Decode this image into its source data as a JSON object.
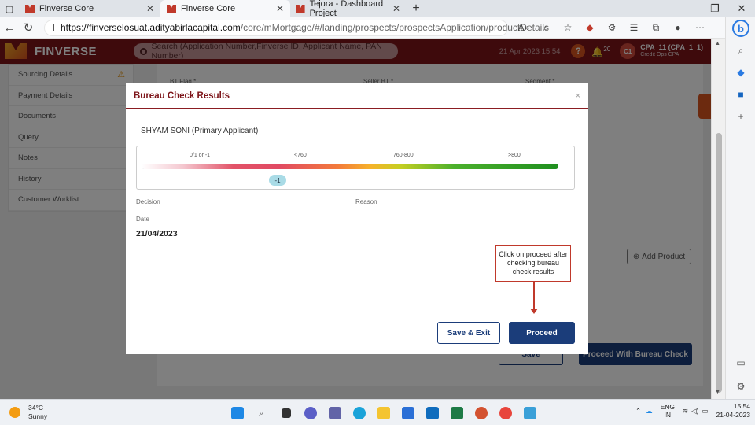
{
  "browser": {
    "tabs": [
      {
        "title": "Finverse Core",
        "active": false
      },
      {
        "title": "Finverse Core",
        "active": true
      },
      {
        "title": "Tejora - Dashboard Project",
        "active": false
      }
    ],
    "url_host": "https://finverselosuat.adityabirlacapital.com",
    "url_path": "/core/mMortgage/#/landing/prospects/prospectsApplication/productDetails"
  },
  "app": {
    "logo": "FINVERSE",
    "search_placeholder": "Search (Application Number,Finverse ID, Applicant Name, PAN Number)",
    "datetime": "21 Apr 2023 15:54",
    "notifications": "20",
    "avatar_initials": "C1",
    "user_name": "CPA_11 (CPA_1_1)",
    "user_role": "Credit Ops CPA",
    "accent_color": "#7d1419",
    "primary_button_color": "#1b3d7a"
  },
  "sidebar": {
    "items": [
      {
        "label": "Sourcing Details"
      },
      {
        "label": "Payment Details"
      },
      {
        "label": "Documents"
      },
      {
        "label": "Query"
      },
      {
        "label": "Notes"
      },
      {
        "label": "History"
      },
      {
        "label": "Customer Worklist"
      }
    ]
  },
  "form": {
    "bt_flag_label": "BT Flag *",
    "seller_bt_label": "Seller BT *",
    "segment_label": "Segment *",
    "add_product": "Add Product",
    "save": "Save",
    "proceed_with_bureau": "Proceed With Bureau Check"
  },
  "modal": {
    "title": "Bureau Check Results",
    "close": "×",
    "applicant": "SHYAM SONI (Primary Applicant)",
    "score_ticks": [
      "0/1 or -1",
      "<760",
      "760-800",
      ">800"
    ],
    "score_value": "-1",
    "decision_label": "Decision",
    "reason_label": "Reason",
    "date_label": "Date",
    "date_value": "21/04/2023",
    "callout": "Click on proceed after checking bureau check results",
    "save_exit": "Save & Exit",
    "proceed": "Proceed"
  },
  "taskbar": {
    "temp": "34°C",
    "weather": "Sunny",
    "lang1": "ENG",
    "lang2": "IN",
    "time": "15:54",
    "date": "21-04-2023"
  }
}
